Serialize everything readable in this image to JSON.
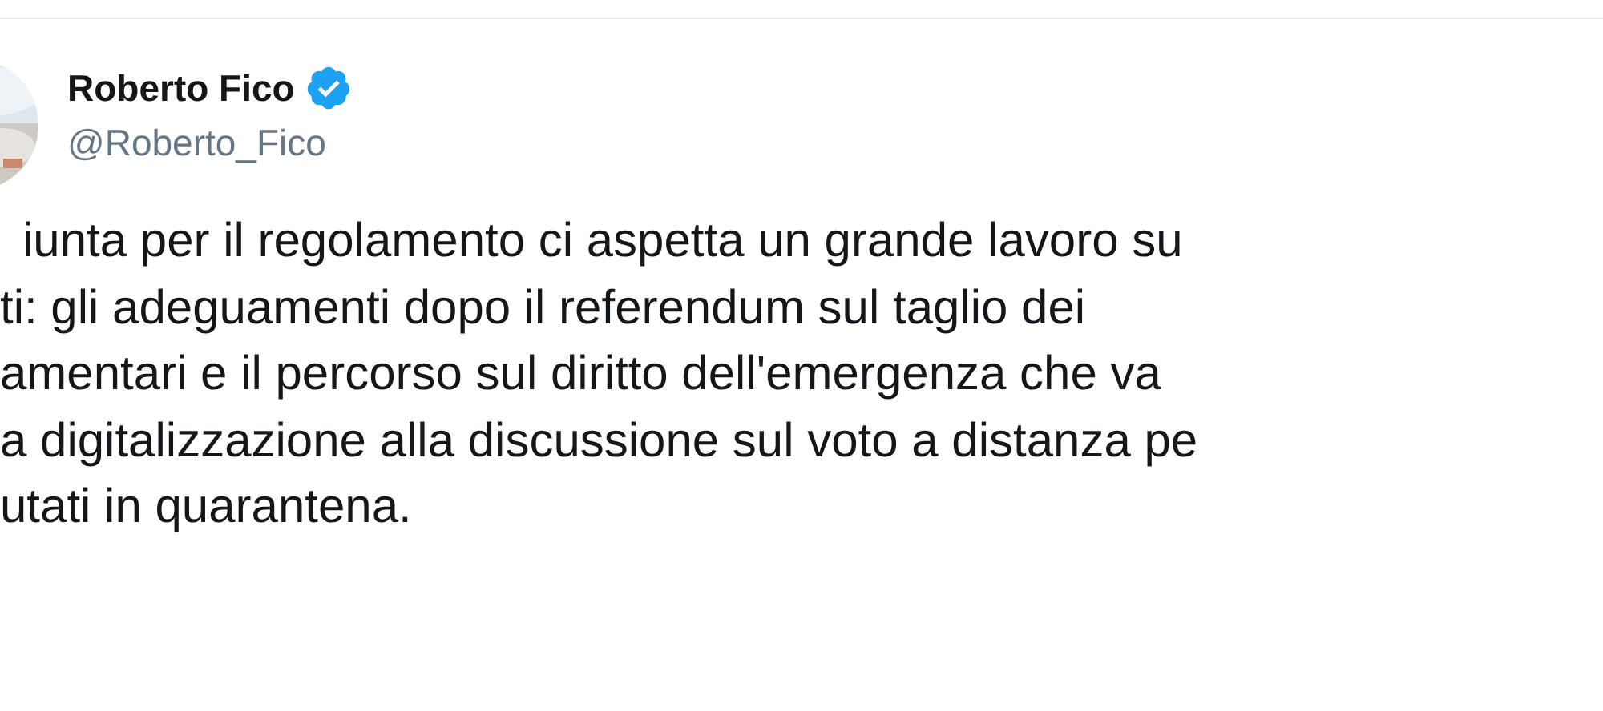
{
  "author": {
    "name": "Roberto Fico",
    "handle": "@Roberto_Fico",
    "verified": true
  },
  "tweet_lines": [
    "iunta per il regolamento ci aspetta un grande lavoro su",
    "ti: gli adeguamenti dopo il referendum sul taglio dei",
    "amentari e il percorso sul diritto dell'emergenza che va",
    "a digitalizzazione alla discussione sul voto a distanza pe",
    "utati in quarantena."
  ]
}
